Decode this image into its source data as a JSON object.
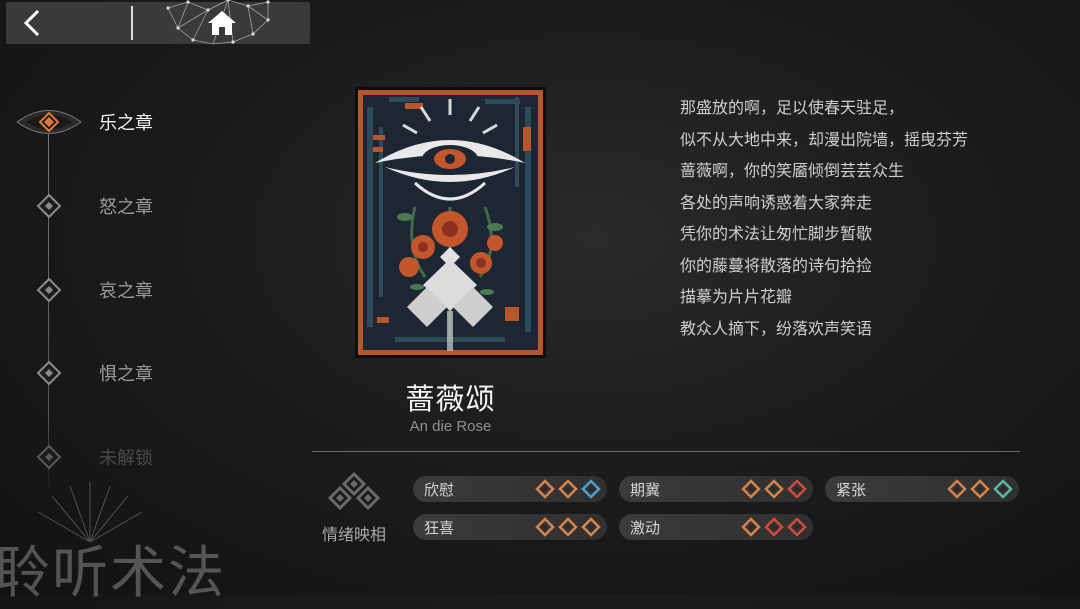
{
  "header": {
    "back_icon": "chevron-left-icon",
    "home_icon": "home-icon"
  },
  "sidebar": {
    "chapters": [
      {
        "label": "乐之章",
        "state": "active"
      },
      {
        "label": "怒之章",
        "state": "normal"
      },
      {
        "label": "哀之章",
        "state": "normal"
      },
      {
        "label": "惧之章",
        "state": "normal"
      },
      {
        "label": "未解锁",
        "state": "locked"
      }
    ]
  },
  "card": {
    "title": "蔷薇颂",
    "subtitle": "An die Rose"
  },
  "poem": {
    "lines": [
      "那盛放的啊，足以使春天驻足，",
      "似不从大地中来，却漫出院墙，摇曳芬芳",
      "蔷薇啊，你的笑靥倾倒芸芸众生",
      "各处的声响诱惑着大家奔走",
      "凭你的术法让匆忙脚步暂歇",
      "你的藤蔓将散落的诗句拾捡",
      "描摹为片片花瓣",
      "教众人摘下，纷落欢声笑语"
    ]
  },
  "emotions": {
    "title": "情绪映相",
    "items": [
      {
        "name": "欣慰",
        "dots": [
          "#d9834a",
          "#d9834a",
          "#4aa3c9"
        ]
      },
      {
        "name": "期冀",
        "dots": [
          "#d9834a",
          "#d9834a",
          "#d14a3a"
        ]
      },
      {
        "name": "紧张",
        "dots": [
          "#d9834a",
          "#d9834a",
          "#5fb5a8"
        ]
      },
      {
        "name": "狂喜",
        "dots": [
          "#d9834a",
          "#d9834a",
          "#d9834a"
        ]
      },
      {
        "name": "激动",
        "dots": [
          "#d9834a",
          "#d14a3a",
          "#d14a3a"
        ]
      }
    ]
  },
  "footer": {
    "deco_text": "聆听术法"
  },
  "colors": {
    "accent_orange": "#d9834a",
    "card_border": "#b8552c",
    "background": "#1c1c1c"
  }
}
